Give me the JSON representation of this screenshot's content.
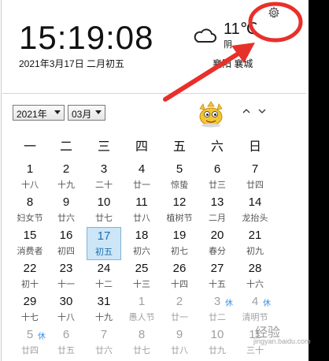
{
  "header": {
    "time": "15:19:08",
    "date": "2021年3月17日 二月初五",
    "weather": {
      "temp": "11℃",
      "condition": "阴",
      "location": "襄阳 襄城",
      "icon": "cloud-icon"
    },
    "settings_icon": "gear-icon"
  },
  "controls": {
    "year_value": "2021年",
    "month_value": "03月",
    "nav_prev": "^",
    "nav_next": "v"
  },
  "weekdays": [
    "一",
    "二",
    "三",
    "四",
    "五",
    "六",
    "日"
  ],
  "colors": {
    "today_bg": "#cde6f7",
    "rest_badge": "#3a8ee6",
    "annotation": "#e8302a"
  },
  "days": [
    {
      "d": "1",
      "l": "十八"
    },
    {
      "d": "2",
      "l": "十九"
    },
    {
      "d": "3",
      "l": "二十"
    },
    {
      "d": "4",
      "l": "廿一"
    },
    {
      "d": "5",
      "l": "惊蛰"
    },
    {
      "d": "6",
      "l": "廿三"
    },
    {
      "d": "7",
      "l": "廿四"
    },
    {
      "d": "8",
      "l": "妇女节"
    },
    {
      "d": "9",
      "l": "廿六"
    },
    {
      "d": "10",
      "l": "廿七"
    },
    {
      "d": "11",
      "l": "廿八"
    },
    {
      "d": "12",
      "l": "植树节"
    },
    {
      "d": "13",
      "l": "二月"
    },
    {
      "d": "14",
      "l": "龙抬头"
    },
    {
      "d": "15",
      "l": "消费者"
    },
    {
      "d": "16",
      "l": "初四"
    },
    {
      "d": "17",
      "l": "初五",
      "today": true
    },
    {
      "d": "18",
      "l": "初六"
    },
    {
      "d": "19",
      "l": "初七"
    },
    {
      "d": "20",
      "l": "春分"
    },
    {
      "d": "21",
      "l": "初九"
    },
    {
      "d": "22",
      "l": "初十"
    },
    {
      "d": "23",
      "l": "十一"
    },
    {
      "d": "24",
      "l": "十二"
    },
    {
      "d": "25",
      "l": "十三"
    },
    {
      "d": "26",
      "l": "十四"
    },
    {
      "d": "27",
      "l": "十五"
    },
    {
      "d": "28",
      "l": "十六"
    },
    {
      "d": "29",
      "l": "十七"
    },
    {
      "d": "30",
      "l": "十八"
    },
    {
      "d": "31",
      "l": "十九"
    },
    {
      "d": "1",
      "l": "愚人节",
      "other": true
    },
    {
      "d": "2",
      "l": "廿一",
      "other": true
    },
    {
      "d": "3",
      "l": "廿二",
      "other": true,
      "rest": "休"
    },
    {
      "d": "4",
      "l": "清明节",
      "other": true,
      "rest": "休"
    },
    {
      "d": "5",
      "l": "廿四",
      "other": true,
      "rest": "休"
    },
    {
      "d": "6",
      "l": "廿五",
      "other": true
    },
    {
      "d": "7",
      "l": "廿六",
      "other": true
    },
    {
      "d": "8",
      "l": "廿七",
      "other": true
    },
    {
      "d": "9",
      "l": "廿八",
      "other": true
    },
    {
      "d": "10",
      "l": "廿九",
      "other": true
    },
    {
      "d": "11",
      "l": "三十",
      "other": true
    }
  ],
  "watermark": {
    "text": "经验",
    "sub": "jingyan.baidu.com"
  }
}
